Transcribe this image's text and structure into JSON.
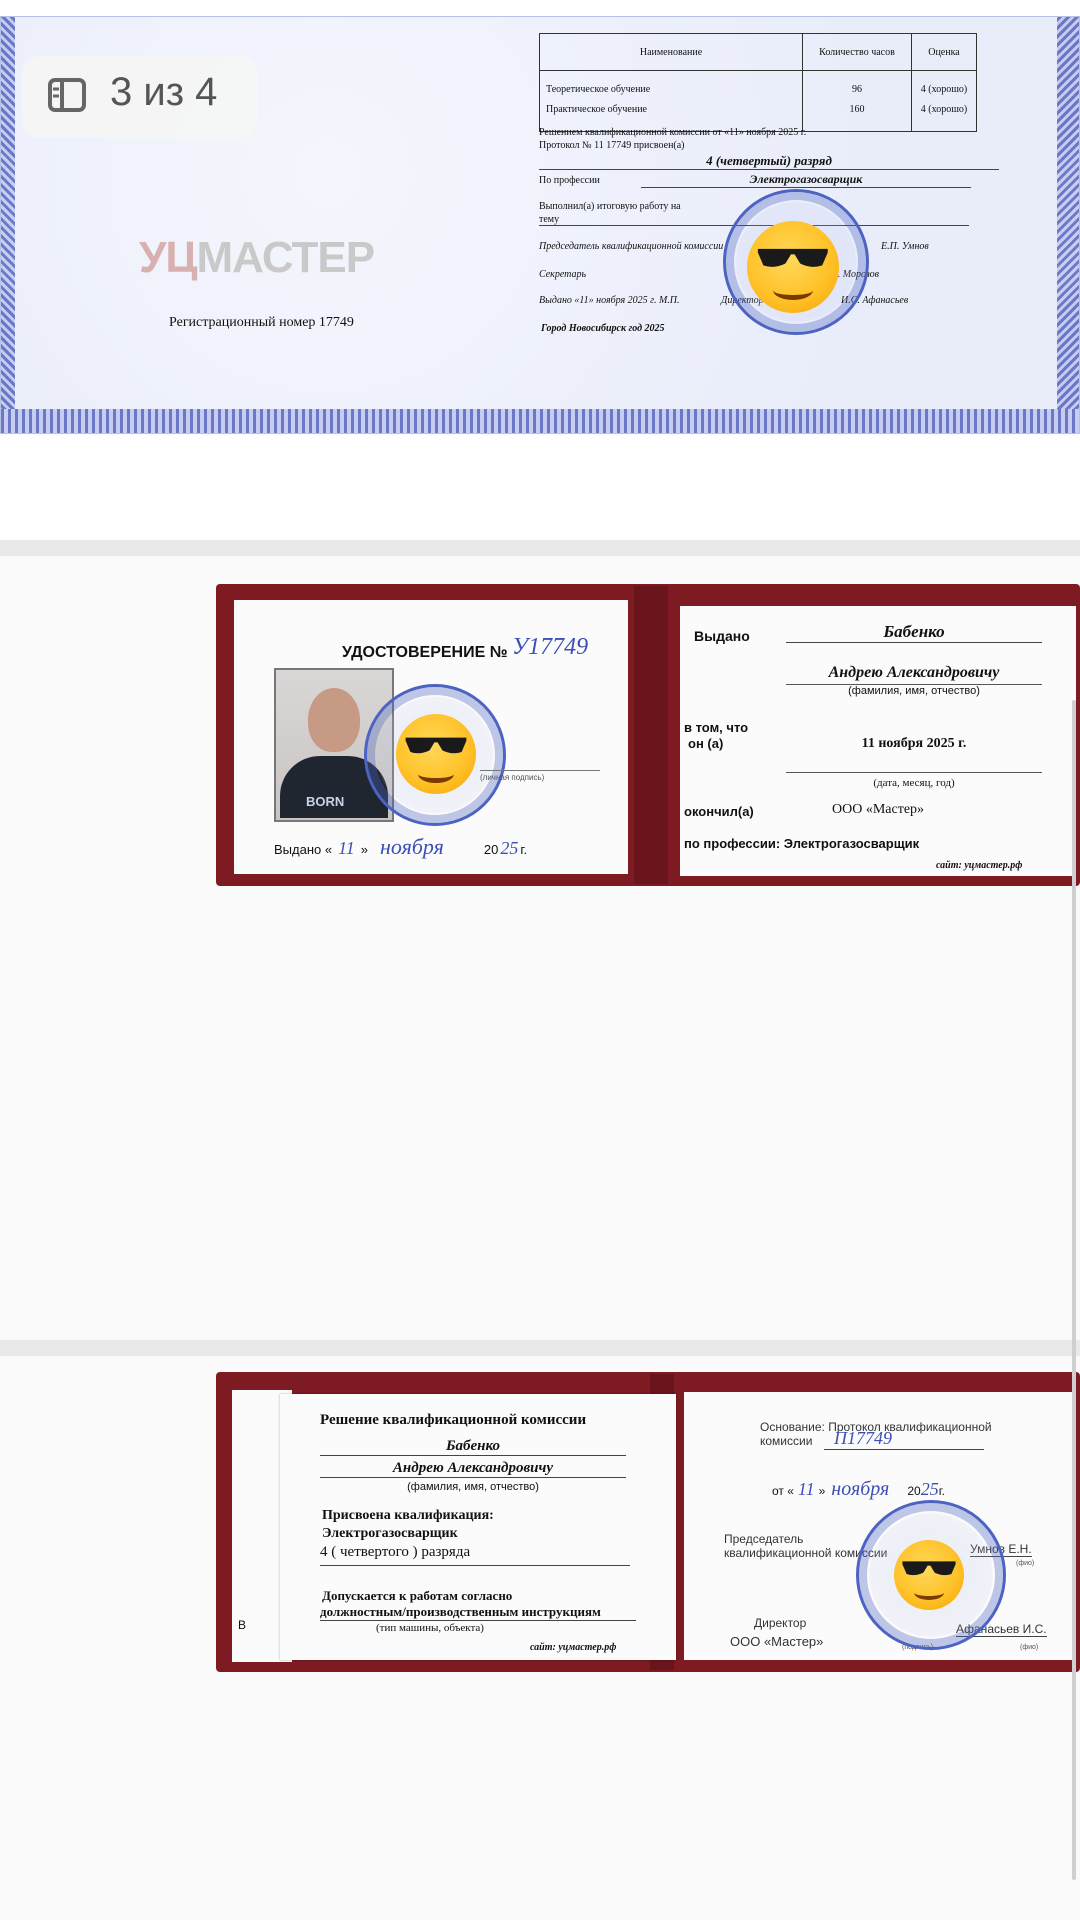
{
  "viewer": {
    "counter": "3 из 4",
    "counter_icon": "gallery-icon"
  },
  "diploma": {
    "logo": {
      "a": "УЦ",
      "b": "МАСТЕР"
    },
    "reg_number": "Регистрационный номер 17749",
    "table": {
      "headers": [
        "Наименование",
        "Количество часов",
        "Оценка"
      ],
      "rows": [
        [
          "Теоретическое обучение",
          "96",
          "4 (хорошо)"
        ],
        [
          "Практическое обучение",
          "160",
          "4 (хорошо)"
        ]
      ]
    },
    "decision1": "Решением квалификационной комиссии от «11» ноября 2025 г.",
    "decision2": "Протокол № 11 17749 присвоен(а)",
    "rank": "4 (четвертый) разряд",
    "profession_label": "По профессии",
    "profession": "Электрогазосварщик",
    "work_label1": "Выполнил(а) итоговую работу на",
    "work_label2": "тему",
    "chair_label": "Председатель квалификационной комиссии",
    "chair_name": "Е.П. Умнов",
    "secretary_label": "Секретарь",
    "secretary_name": "Л. Морозов",
    "issued_label": "Выдано «11» ноября 2025 г.  М.П.",
    "director_label": "Директор",
    "director_name": "И.С. Афанасьев",
    "city": "Город Новосибирск год 2025"
  },
  "card1": {
    "title": "УДОСТОВЕРЕНИЕ №",
    "number": "У17749",
    "sign_label": "(личная подпись)",
    "issued_prefix": "Выдано «",
    "issued_day": "11",
    "issued_mid": "»",
    "issued_month": "ноября",
    "issued_year_prefix": "20",
    "issued_year": "25",
    "issued_suffix": "г.",
    "photo_text": "BORN",
    "issued_to_label": "Выдано",
    "surname": "Бабенко",
    "name": "Андрею Александровичу",
    "fio_hint": "(фамилия, имя, отчество)",
    "that_label1": "в том, что",
    "that_label2": "он (а)",
    "date": "11 ноября 2025  г.",
    "date_hint": "(дата, месяц, год)",
    "finished_label": "окончил(а)",
    "org": "ООО «Мастер»",
    "profession_line": "по профессии: Электрогазосварщик",
    "site": "сайт: уцмастер.рф"
  },
  "card2": {
    "heading": "Решение квалификационной комиссии",
    "surname": "Бабенко",
    "name": "Андрею Александровичу",
    "fio_hint": "(фамилия, имя, отчество)",
    "qual_label": "Присвоена квалификация:",
    "qual": "Электрогазосварщик",
    "grade": "4  ( четвертого ) разряда",
    "allowed1": "Допускается к работам согласно",
    "allowed2": "должностным/производственным инструкциям",
    "machine_hint": "(тип машины, объекта)",
    "site": "сайт: уцмастер.рф",
    "left_edge_letter": "В",
    "basis1": "Основание: Протокол квалификационной",
    "basis2": "комиссии",
    "protocol_no": "П17749",
    "date_prefix": "от «",
    "date_day": "11",
    "date_mid": "»",
    "date_month": "ноября",
    "date_year_prefix": "20",
    "date_year": "25",
    "date_suffix": "г.",
    "chair1": "Председатель",
    "chair2": "квалификационной комиссии",
    "chair_name": "Умнов Е.Н.",
    "fio_small": "(фио)",
    "director": "Директор",
    "org": "ООО «Мастер»",
    "sign_small": "(подпись)",
    "director_name": "Афанасьев И.С.",
    "fio_small2": "(фио)"
  }
}
